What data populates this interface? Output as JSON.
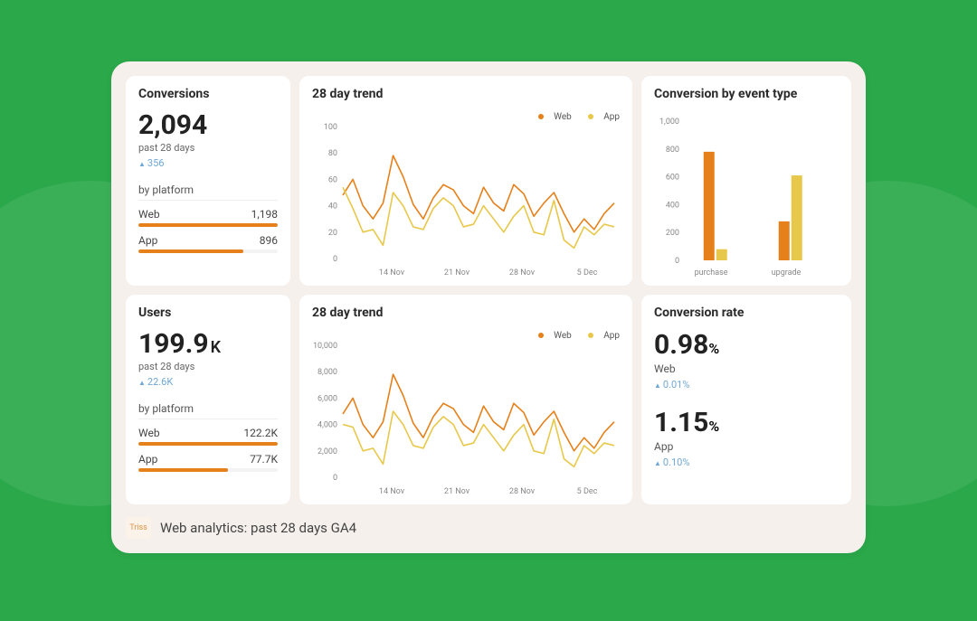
{
  "colors": {
    "web": "#e6801a",
    "app": "#e8c84a",
    "delta": "#6fa8d6"
  },
  "conversions": {
    "title": "Conversions",
    "value": "2,094",
    "subtext": "past 28 days",
    "delta": "356",
    "platform_label": "by platform",
    "platforms": [
      {
        "label": "Web",
        "value": "1,198",
        "pct": 100
      },
      {
        "label": "App",
        "value": "896",
        "pct": 75
      }
    ]
  },
  "trend_conversions": {
    "title": "28 day trend",
    "legend": {
      "web": "Web",
      "app": "App"
    }
  },
  "conversion_by_event": {
    "title": "Conversion by event type"
  },
  "users": {
    "title": "Users",
    "value": "199.9",
    "suffix": "K",
    "subtext": "past 28 days",
    "delta": "22.6K",
    "platform_label": "by platform",
    "platforms": [
      {
        "label": "Web",
        "value": "122.2K",
        "pct": 100
      },
      {
        "label": "App",
        "value": "77.7K",
        "pct": 64
      }
    ]
  },
  "trend_users": {
    "title": "28 day trend",
    "legend": {
      "web": "Web",
      "app": "App"
    }
  },
  "conversion_rate": {
    "title": "Conversion rate",
    "rates": [
      {
        "value": "0.98",
        "pct": "%",
        "label": "Web",
        "delta": "0.01%"
      },
      {
        "value": "1.15",
        "pct": "%",
        "label": "App",
        "delta": "0.10%"
      }
    ]
  },
  "footer": {
    "icon_text": "Triss",
    "text": "Web analytics: past 28 days GA4"
  },
  "chart_data": [
    {
      "id": "trend_conversions",
      "type": "line",
      "title": "28 day trend",
      "ylabel": "",
      "ylim": [
        0,
        100
      ],
      "yticks": [
        0,
        20,
        40,
        60,
        80,
        100
      ],
      "x_tick_labels": [
        "14 Nov",
        "21 Nov",
        "28 Nov",
        "5 Dec"
      ],
      "x": [
        1,
        2,
        3,
        4,
        5,
        6,
        7,
        8,
        9,
        10,
        11,
        12,
        13,
        14,
        15,
        16,
        17,
        18,
        19,
        20,
        21,
        22,
        23,
        24,
        25,
        26,
        27,
        28
      ],
      "series": [
        {
          "name": "Web",
          "color": "#e6801a",
          "values": [
            48,
            60,
            40,
            30,
            42,
            78,
            62,
            41,
            30,
            46,
            56,
            52,
            40,
            34,
            54,
            42,
            36,
            56,
            49,
            32,
            42,
            50,
            34,
            20,
            30,
            22,
            34,
            42
          ]
        },
        {
          "name": "App",
          "color": "#e8c84a",
          "values": [
            54,
            38,
            20,
            22,
            10,
            50,
            40,
            24,
            22,
            38,
            46,
            40,
            24,
            26,
            40,
            30,
            20,
            32,
            40,
            20,
            18,
            44,
            14,
            8,
            24,
            18,
            26,
            24
          ]
        }
      ]
    },
    {
      "id": "conversion_by_event",
      "type": "bar",
      "title": "Conversion by event type",
      "ylim": [
        0,
        1000
      ],
      "yticks": [
        0,
        200,
        400,
        600,
        800,
        1000
      ],
      "categories": [
        "purchase",
        "upgrade"
      ],
      "series": [
        {
          "name": "Web",
          "color": "#e6801a",
          "values": [
            780,
            280
          ]
        },
        {
          "name": "App",
          "color": "#e8c84a",
          "values": [
            80,
            610
          ]
        }
      ]
    },
    {
      "id": "trend_users",
      "type": "line",
      "title": "28 day trend",
      "ylabel": "",
      "ylim": [
        0,
        10000
      ],
      "yticks": [
        0,
        2000,
        4000,
        6000,
        8000,
        10000
      ],
      "x_tick_labels": [
        "14 Nov",
        "21 Nov",
        "28 Nov",
        "5 Dec"
      ],
      "x": [
        1,
        2,
        3,
        4,
        5,
        6,
        7,
        8,
        9,
        10,
        11,
        12,
        13,
        14,
        15,
        16,
        17,
        18,
        19,
        20,
        21,
        22,
        23,
        24,
        25,
        26,
        27,
        28
      ],
      "series": [
        {
          "name": "Web",
          "color": "#e6801a",
          "values": [
            4800,
            6000,
            4000,
            3000,
            4200,
            7800,
            6200,
            4100,
            3000,
            4600,
            5600,
            5200,
            4000,
            3400,
            5400,
            4200,
            3600,
            5600,
            4900,
            3200,
            4200,
            5000,
            3400,
            2000,
            3000,
            2200,
            3400,
            4200
          ]
        },
        {
          "name": "App",
          "color": "#e8c84a",
          "values": [
            4000,
            3800,
            2000,
            2200,
            1000,
            5000,
            4000,
            2400,
            2200,
            3800,
            4600,
            4000,
            2400,
            2600,
            4000,
            3000,
            2000,
            3200,
            4000,
            2000,
            1800,
            4400,
            1400,
            800,
            2400,
            1800,
            2600,
            2400
          ]
        }
      ]
    }
  ]
}
